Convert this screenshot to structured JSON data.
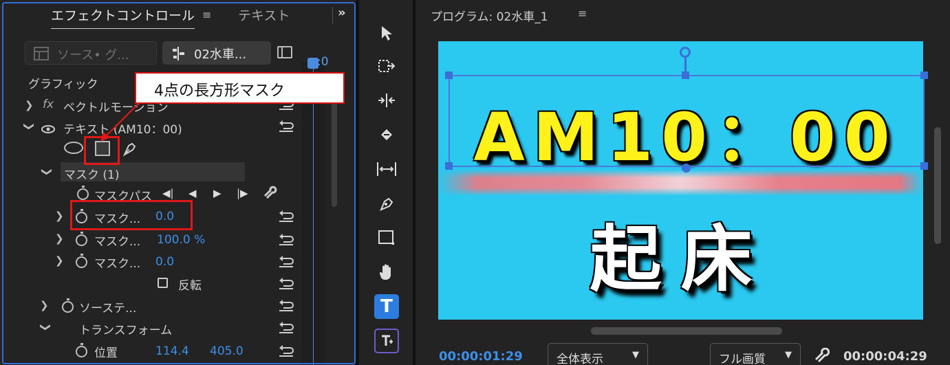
{
  "effect_controls": {
    "tab_label": "エフェクトコントロール",
    "tab_menu_icon": "≡",
    "text_tab_label": "テキスト",
    "overflow_icon": "»",
    "source_selector": "ソース• グ...",
    "clip_selector": "02水車...",
    "playhead_time": ":0",
    "section_label": "グラフィック",
    "vector_motion_fx": "fx",
    "vector_motion_label": "ベクトルモーション",
    "text_layer_label": "テキスト (AM10：00)",
    "mask_group_label": "マスク (1)",
    "mask_path_label": "マスクパス",
    "mask_path_controls": [
      "◀|",
      "◀",
      "▶",
      "|▶",
      "🔧"
    ],
    "mask_feather_label": "マスク...",
    "mask_feather_value": "0.0",
    "mask_opacity_label": "マスク...",
    "mask_opacity_value": "100.0 %",
    "mask_expansion_label": "マスク...",
    "mask_expansion_value": "0.0",
    "invert_label": "反転",
    "source_text_label": "ソーステ...",
    "transform_label": "トランスフォーム",
    "position_label": "位置",
    "position_x": "114.4",
    "position_y": "405.0"
  },
  "annotation": {
    "callout_text": "4点の長方形マスク",
    "highlight_color": "#e01818"
  },
  "tools": {
    "type_tool_glyph": "T",
    "active_color": "#2d7ce0"
  },
  "program_monitor": {
    "title": "プログラム: 02水車_1",
    "menu_icon": "≡",
    "frame_title": "AM10：00",
    "frame_subtitle": "起床",
    "current_time": "00:00:01:29",
    "zoom_value": "全体表示",
    "quality_value": "フル画質",
    "duration": "00:00:04:29",
    "frame_bg_color": "#2bc8ef",
    "title_color": "#fff21a"
  }
}
